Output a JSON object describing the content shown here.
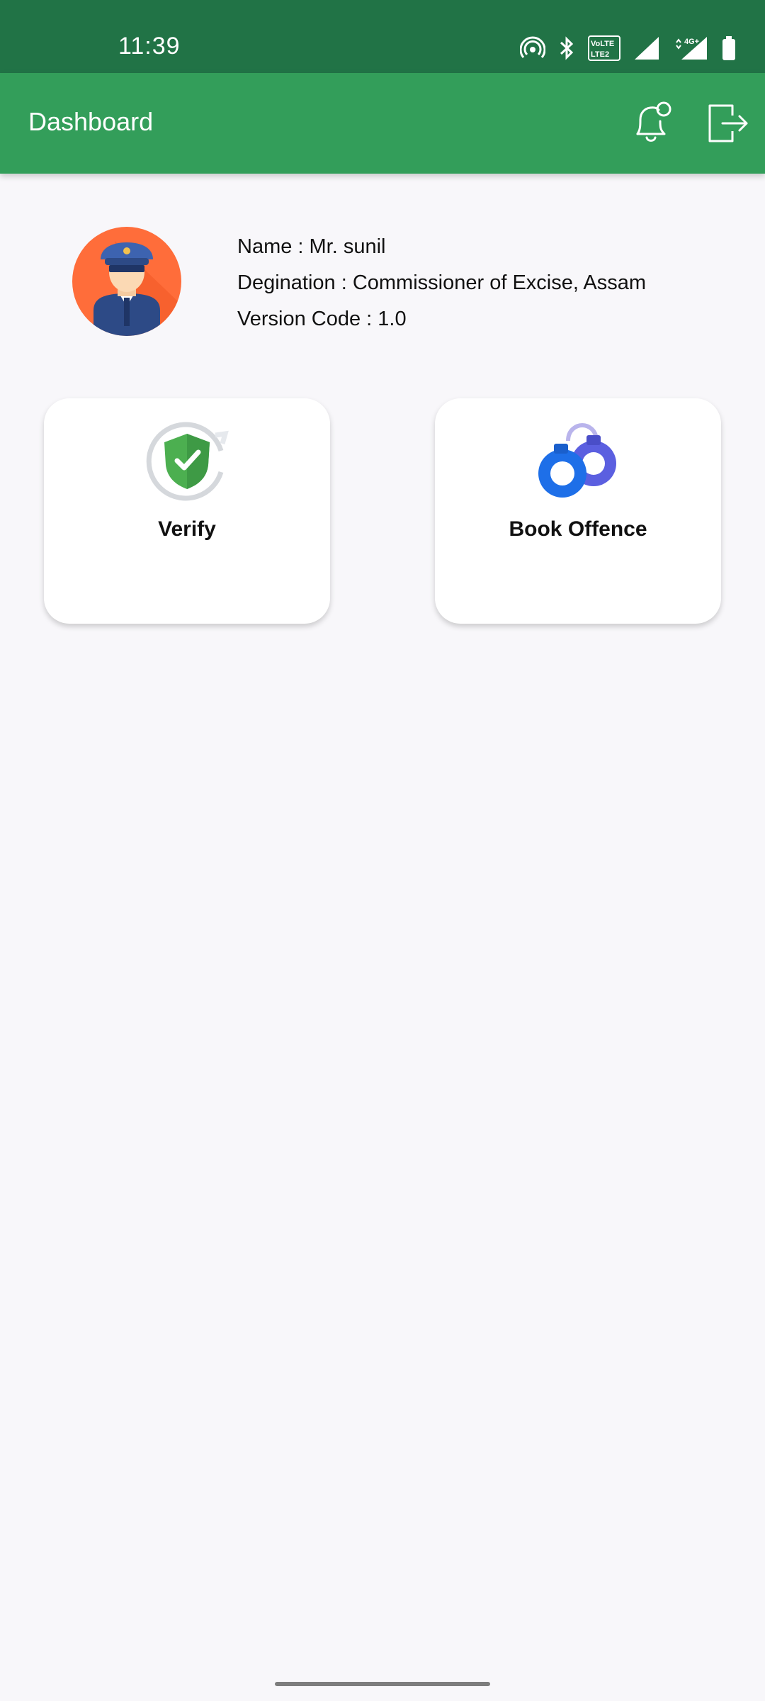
{
  "status_bar": {
    "time": "11:39",
    "lte_label_top": "VoLTE",
    "lte_label_bottom": "LTE2",
    "network_label": "4G+",
    "icons": [
      "hotspot-icon",
      "bluetooth-icon",
      "volte-icon",
      "signal-icon",
      "signal-4g-icon",
      "battery-icon"
    ]
  },
  "app_bar": {
    "title": "Dashboard",
    "bell_icon": "notification-bell-icon",
    "logout_icon": "logout-icon"
  },
  "profile": {
    "name_line": "Name : Mr. sunil",
    "designation_line": "Degination : Commissioner of Excise, Assam",
    "version_line": "Version Code : 1.0"
  },
  "tiles": [
    {
      "label": "Verify",
      "icon": "verify-shield-icon"
    },
    {
      "label": "Book Offence",
      "icon": "handcuffs-icon"
    }
  ],
  "colors": {
    "status_bar": "#217346",
    "app_bar": "#339e5a",
    "background": "#f8f7fa",
    "avatar_bg": "#ff6d3a",
    "verify_green": "#4caf50",
    "handcuff_blue": "#1e6fe8"
  }
}
